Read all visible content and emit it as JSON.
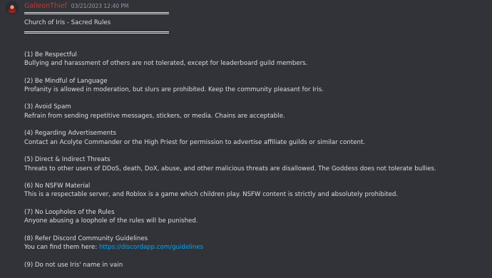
{
  "message": {
    "author": "GalleonThief",
    "timestamp": "03/21/2023 12:40 PM",
    "title": "Church of Iris - Sacred Rules",
    "rules": [
      {
        "title": "(1) Be Respectful",
        "desc": "Bullying and harassment of others are not tolerated, except for leaderboard guild members."
      },
      {
        "title": "(2) Be Mindful of Language",
        "desc": "Profanity is allowed in moderation, but slurs are prohibited. Keep the community pleasant for Iris."
      },
      {
        "title": "(3) Avoid Spam",
        "desc": "Refrain from sending repetitive messages, stickers, or media. Chains are acceptable."
      },
      {
        "title": "(4) Regarding Advertisements",
        "desc": "Contact an Acolyte Commander or the High Priest for permission to advertise affiliate guilds or similar content."
      },
      {
        "title": "(5) Direct & Indirect Threats",
        "desc": "Threats to other users of DDoS, death, DoX, abuse, and other malicious threats are disallowed. The Goddess does not tolerate bullies."
      },
      {
        "title": "(6) No NSFW Material",
        "desc": "This is a respectable server, and Roblox is a game which children play. NSFW content is strictly and absolutely prohibited."
      },
      {
        "title": "(7) No Loopholes of the Rules",
        "desc": "Anyone abusing a loophole of the rules will be punished."
      }
    ],
    "rule8": {
      "title": "(8) Refer Discord Community Guidelines",
      "desc_prefix": "You can find them here: ",
      "link": "https://discordapp.com/guidelines"
    },
    "rule9": {
      "title": "(9) Do not use Iris' name in vain"
    }
  },
  "colors": {
    "background": "#313338",
    "author": "#c23a3a",
    "link": "#00a8fc"
  }
}
